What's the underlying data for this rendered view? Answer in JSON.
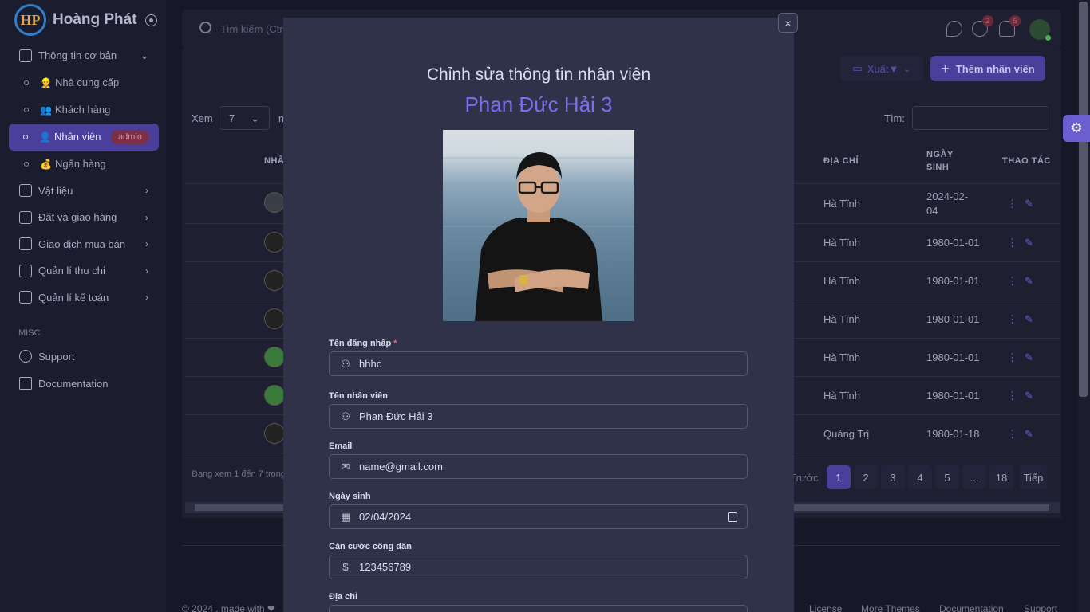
{
  "brand": {
    "name": "Hoàng Phát",
    "logo_text": "HP"
  },
  "sidebar": {
    "sections": [
      {
        "label": "Thông tin cơ bản",
        "expanded": true,
        "items": [
          {
            "emoji": "👷",
            "label": "Nhà cung cấp"
          },
          {
            "emoji": "👥",
            "label": "Khách hàng"
          },
          {
            "emoji": "👤",
            "label": "Nhân viên",
            "badge": "admin",
            "active": true
          },
          {
            "emoji": "💰",
            "label": "Ngân hàng"
          }
        ]
      },
      {
        "label": "Vật liệu"
      },
      {
        "label": "Đặt và giao hàng"
      },
      {
        "label": "Giao dịch mua bán"
      },
      {
        "label": "Quản lí thu chi"
      },
      {
        "label": "Quản lí kế toán"
      }
    ],
    "misc_title": "MISC",
    "misc_links": [
      "Support",
      "Documentation"
    ]
  },
  "topbar": {
    "search_placeholder": "Tìm kiếm (Ctrl+/)",
    "chat_count": "2",
    "notif_count": "5"
  },
  "toolbar": {
    "export_label": "Xuất▼",
    "add_label": "Thêm nhân viên"
  },
  "table": {
    "show_label": "Xem",
    "show_value": "7",
    "show_suffix": "m",
    "search_label": "Tìm:",
    "headers": {
      "name": "NHÂ",
      "address": "ĐỊA CHỈ",
      "birth_line1": "NGÀY",
      "birth_line2": "SINH",
      "actions": "THAO TÁC"
    },
    "rows": [
      {
        "address": "Hà Tĩnh",
        "birth": "2024-02-04"
      },
      {
        "address": "Hà Tĩnh",
        "birth": "1980-01-01"
      },
      {
        "address": "Hà Tĩnh",
        "birth": "1980-01-01"
      },
      {
        "address": "Hà Tĩnh",
        "birth": "1980-01-01"
      },
      {
        "address": "Hà Tĩnh",
        "birth": "1980-01-01"
      },
      {
        "address": "Hà Tĩnh",
        "birth": "1980-01-01"
      },
      {
        "address": "Quảng Trị",
        "birth": "1980-01-18"
      }
    ],
    "info": "Đang xem 1 đến 7 trong",
    "pagination": {
      "prev": "Trước",
      "pages": [
        "1",
        "2",
        "3",
        "4",
        "5",
        "...",
        "18"
      ],
      "next": "Tiếp"
    }
  },
  "footer": {
    "copyright": "© 2024 , made with ❤",
    "links": [
      "License",
      "More Themes",
      "Documentation",
      "Support"
    ]
  },
  "modal": {
    "title": "Chỉnh sửa thông tin nhân viên",
    "employee_name": "Phan Đức Hải 3",
    "fields": {
      "username": {
        "label": "Tên đăng nhập",
        "value": "hhhc",
        "required_mark": "*"
      },
      "fullname": {
        "label": "Tên nhân viên",
        "value": "Phan Đức Hải 3"
      },
      "email": {
        "label": "Email",
        "value": "name@gmail.com"
      },
      "birthdate": {
        "label": "Ngày sinh",
        "value": "02/04/2024"
      },
      "citizen_id": {
        "label": "Căn cước công dân",
        "value": "123456789"
      },
      "address": {
        "label": "Địa chỉ"
      }
    },
    "close_label": "×"
  }
}
